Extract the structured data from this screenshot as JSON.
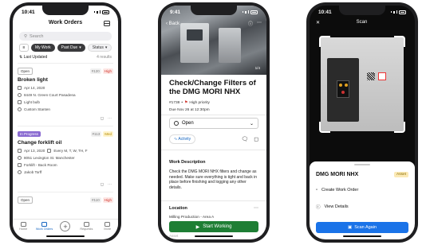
{
  "phone1": {
    "status_time": "10:41",
    "title": "Work Orders",
    "search_placeholder": "Search",
    "filters": {
      "my_work": "My Work",
      "past_due": "Past Due",
      "status": "Status"
    },
    "sort_label": "Last Updated",
    "result_count": "4 results",
    "work_orders": [
      {
        "status": "Open",
        "id": "#120",
        "priority": "High",
        "title": "Broken light",
        "date": "Apr 14, 2020",
        "address": "8449 N. Green Court Pasadena",
        "asset": "Light bulb",
        "assignee": "Custom Stanten"
      },
      {
        "status": "In Progress",
        "id": "#113",
        "priority": "Med",
        "title": "Change forklift oil",
        "date": "Apr 13, 2020",
        "recurrence": "Every M, T, W, TH, F",
        "address": "8051 Lexington St. Manchester",
        "asset": "Forklift - Back Room",
        "assignee": "Jakob Torff"
      },
      {
        "status": "Open",
        "id": "#110",
        "priority": "High"
      }
    ],
    "tabs": [
      "Home",
      "Work Orders",
      "",
      "Requests",
      "More"
    ]
  },
  "phone2": {
    "status_time": "9:41",
    "back_label": "Back",
    "image_counter": "1/4",
    "title": "Check/Change Filters of the DMG MORI NHX",
    "wo_id": "#1738",
    "priority": "High priority",
    "due": "Due Nov 26 at 12:30pm",
    "status": "Open",
    "activity_label": "Activity",
    "desc_heading": "Work Description",
    "description": "Check the DMG MORI NHX filters and change as needed. Make sure everything is tight and back in place before finishing and logging any other details.",
    "location_heading": "Location",
    "location": "Milling Production - Area A",
    "start_button": "Start Working",
    "asset_label": "Asset"
  },
  "phone3": {
    "status_time": "10:41",
    "title": "Scan",
    "asset_name": "DMG MORI NHX",
    "asset_badge": "Asset",
    "create_label": "Create Work Order",
    "view_label": "View Details",
    "scan_again": "Scan Again"
  },
  "colors": {
    "accent": "#1565c0",
    "green": "#1e7e34",
    "purple": "#8a6bd1",
    "high": "#d0342c",
    "scan_blue": "#1a73e8"
  }
}
